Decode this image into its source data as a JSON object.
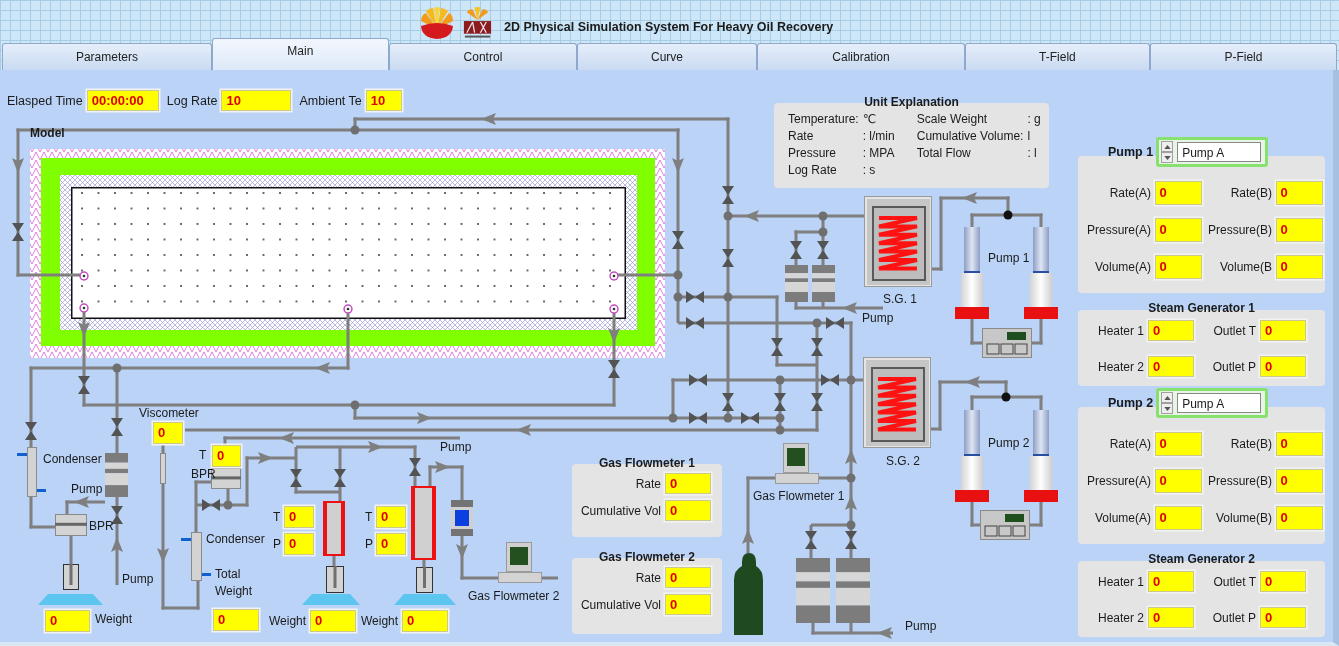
{
  "window": {
    "title": "2D Physical Simulation System For Heavy Oil Recovery"
  },
  "tabs": [
    {
      "label": "Parameters",
      "selected": false
    },
    {
      "label": "Main",
      "selected": true
    },
    {
      "label": "Control",
      "selected": false
    },
    {
      "label": "Curve",
      "selected": false
    },
    {
      "label": "Calibration",
      "selected": false
    },
    {
      "label": "T-Field",
      "selected": false
    },
    {
      "label": "P-Field",
      "selected": false
    }
  ],
  "status_fields": [
    {
      "label": "Elasped Time",
      "value": "00:00:00"
    },
    {
      "label": "Log Rate",
      "value": "10"
    },
    {
      "label": "Ambient Te",
      "value": "10"
    }
  ],
  "unit_explanation": {
    "title": "Unit Explanation",
    "columns": [
      [
        {
          "label": "Temperature:",
          "unit": "℃"
        },
        {
          "label": "Rate",
          "unit": ": l/min"
        },
        {
          "label": "Pressure",
          "unit": ": MPA"
        },
        {
          "label": "Log Rate",
          "unit": ": s"
        }
      ],
      [
        {
          "label": "Scale Weight",
          "unit": ": g"
        },
        {
          "label": "Cumulative Volume:",
          "unit": "l"
        },
        {
          "label": "Total Flow",
          "unit": ": l"
        }
      ]
    ]
  },
  "diagram": {
    "model": {
      "title": "Model"
    },
    "labels": [
      "Pump 1",
      "S.G. 1",
      "Pump",
      "Pump 2",
      "S.G. 2",
      "Gas Flowmeter 1",
      "Pump",
      "Condenser",
      "Pump",
      "BPR",
      "Pump",
      "BPR",
      "Pump",
      "Condenser",
      "Gas Flowmeter 2"
    ],
    "readouts": [
      {
        "label": "Weight",
        "value": "0"
      },
      {
        "label": "Viscometer",
        "value": "0"
      },
      {
        "label": "T",
        "value": "0"
      },
      {
        "label": "Total Weight",
        "value": "0"
      },
      {
        "label": "T",
        "value": "0"
      },
      {
        "label": "P",
        "value": "0"
      },
      {
        "label": "Weight",
        "value": "0"
      },
      {
        "label": "T",
        "value": "0"
      },
      {
        "label": "P",
        "value": "0"
      },
      {
        "label": "Weight",
        "value": "0"
      }
    ]
  },
  "gas_flowmeter_panels": [
    {
      "title": "Gas Flowmeter 1",
      "fields": [
        {
          "label": "Rate",
          "value": "0"
        },
        {
          "label": "Cumulative Vol",
          "value": "0"
        }
      ]
    },
    {
      "title": "Gas Flowmeter 2",
      "fields": [
        {
          "label": "Rate",
          "value": "0"
        },
        {
          "label": "Cumulative Vol",
          "value": "0"
        }
      ]
    }
  ],
  "right_panels": [
    {
      "kind": "pump",
      "title": "Pump 1",
      "selector": "Pump A",
      "fields": [
        {
          "label": "Rate(A)",
          "value": "0"
        },
        {
          "label": "Rate(B)",
          "value": "0"
        },
        {
          "label": "Pressure(A)",
          "value": "0"
        },
        {
          "label": "Pressure(B)",
          "value": "0"
        },
        {
          "label": "Volume(A)",
          "value": "0"
        },
        {
          "label": "Volume(B",
          "value": "0"
        }
      ]
    },
    {
      "kind": "steam_generator",
      "title": "Steam Generator 1",
      "fields": [
        {
          "label": "Heater 1",
          "value": "0"
        },
        {
          "label": "Outlet T",
          "value": "0"
        },
        {
          "label": "Heater 2",
          "value": "0"
        },
        {
          "label": "Outlet P",
          "value": "0"
        }
      ]
    },
    {
      "kind": "pump",
      "title": "Pump 2",
      "selector": "Pump A",
      "fields": [
        {
          "label": "Rate(A)",
          "value": "0"
        },
        {
          "label": "Rate(B)",
          "value": "0"
        },
        {
          "label": "Pressure(A)",
          "value": "0"
        },
        {
          "label": "Pressure(B)",
          "value": "0"
        },
        {
          "label": "Volume(A)",
          "value": "0"
        },
        {
          "label": "Volume(B)",
          "value": "0"
        }
      ]
    },
    {
      "kind": "steam_generator",
      "title": "Steam Generator 2",
      "fields": [
        {
          "label": "Heater 1",
          "value": "0"
        },
        {
          "label": "Outlet T",
          "value": "0"
        },
        {
          "label": "Heater 2",
          "value": "0"
        },
        {
          "label": "Outlet P",
          "value": "0"
        }
      ]
    }
  ]
}
